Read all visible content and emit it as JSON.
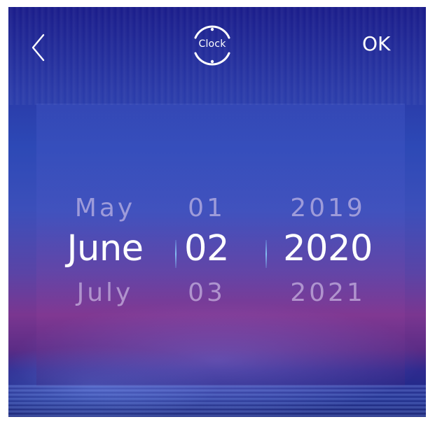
{
  "header": {
    "back_icon": "chevron-left-icon",
    "clock_label": "Clock",
    "ok_label": "OK"
  },
  "picker": {
    "month": {
      "prev": "May",
      "selected": "June",
      "next": "July"
    },
    "day": {
      "prev": "01",
      "selected": "02",
      "next": "03"
    },
    "year": {
      "prev": "2019",
      "selected": "2020",
      "next": "2021"
    }
  },
  "colors": {
    "selected_text": "#ffffff",
    "unselected_text": "#d7c8eb",
    "divider": "#8cd2ff",
    "background_top": "#1a1c8a",
    "background_mid": "#7a3690"
  }
}
